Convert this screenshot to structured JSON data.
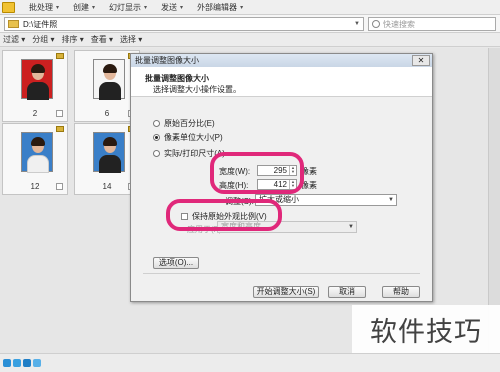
{
  "menubar": {
    "items": [
      {
        "label": "批处理",
        "caret": "▾"
      },
      {
        "label": "创建",
        "caret": "▾"
      },
      {
        "label": "幻灯显示",
        "caret": "▾"
      },
      {
        "label": "发送",
        "caret": "▾"
      },
      {
        "label": "外部编辑器",
        "caret": "▾"
      }
    ]
  },
  "pathbar": {
    "path": "D:\\证件照",
    "search_placeholder": "快速搜索"
  },
  "filterbar": {
    "items": [
      "过滤",
      "分组",
      "排序",
      "查看",
      "选择"
    ],
    "caret": "▾"
  },
  "thumbnails": [
    {
      "label": "2",
      "background": "red"
    },
    {
      "label": "6",
      "background": "white"
    },
    {
      "label": "12",
      "background": "blue"
    },
    {
      "label": "14",
      "background": "blue"
    }
  ],
  "dialog": {
    "title": "批量调整图像大小",
    "close_symbol": "✕",
    "header_title": "批量调整图像大小",
    "header_subtitle": "选择调整大小操作设置。",
    "options": {
      "percent": "原始百分比(E)",
      "pixels": "像素单位大小(P)",
      "print": "实际/打印尺寸(A)"
    },
    "width_label": "宽度(W):",
    "width_value": "295",
    "height_label": "高度(H):",
    "height_value": "412",
    "unit": "像素",
    "resize_label": "调整(S):",
    "resize_value": "扩大或缩小",
    "keep_aspect_label": "保持原始外观比例(V)",
    "apply_to_label": "应用于(P):",
    "apply_to_value": "宽度和高度",
    "options_button": "选项(O)...",
    "start_button": "开始调整大小(S)",
    "cancel_button": "取消",
    "help_button": "帮助"
  },
  "watermark": "软件技巧",
  "colors": {
    "highlight_ring": "#e0287a"
  }
}
